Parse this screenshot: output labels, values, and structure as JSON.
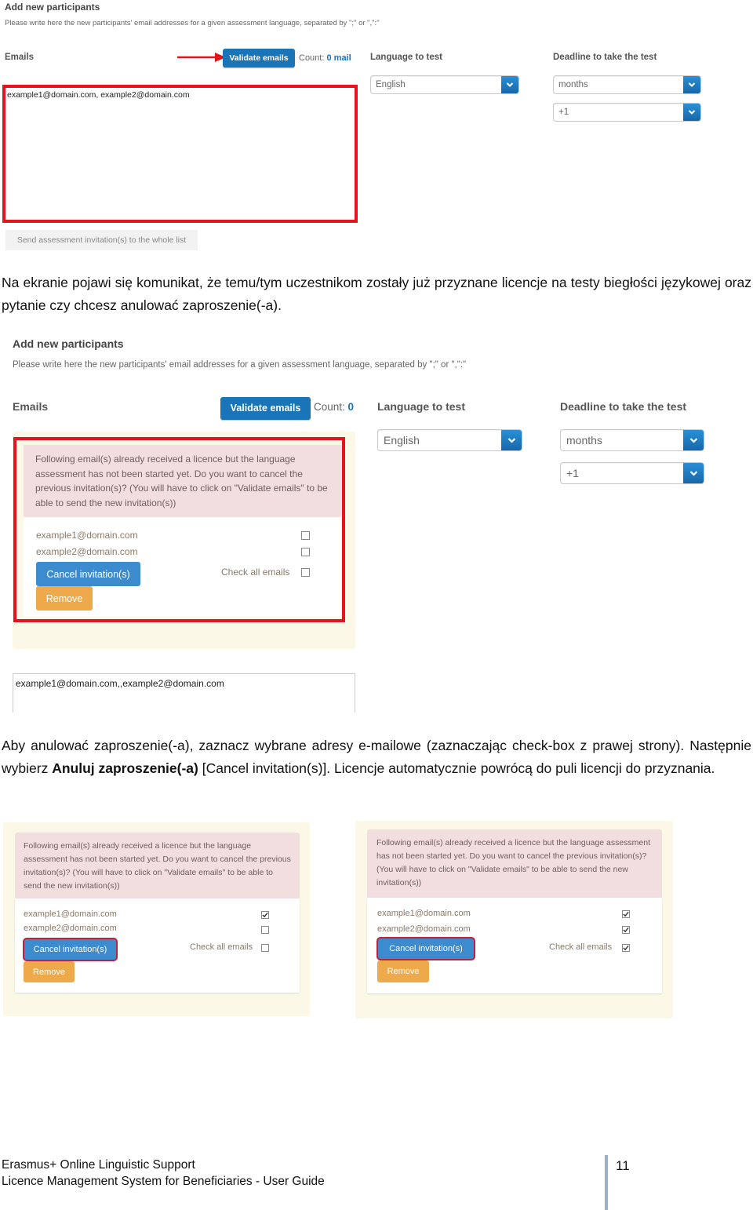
{
  "screenshot1": {
    "title": "Add new participants",
    "subtitle": "Please write here the new participants' email addresses for a given assessment language, separated by \";\" or \",\":\"",
    "emails_label": "Emails",
    "validate_label": "Validate emails",
    "count_prefix": "Count:",
    "count_value": "0 mail",
    "language_label": "Language to test",
    "language_value": "English",
    "deadline_label": "Deadline to take the test",
    "deadline_unit": "months",
    "deadline_amount": "+1",
    "emails_value": "example1@domain.com, example2@domain.com",
    "send_label": "Send assessment invitation(s) to the whole list",
    "annotation_color": "#e3141b"
  },
  "paragraph1": "Na ekranie pojawi się komunikat, że temu/tym uczestnikom zostały już przyznane licencje na testy biegłości językowej oraz pytanie czy chcesz anulować zaproszenie(-a).",
  "screenshot2": {
    "title": "Add new participants",
    "subtitle": "Please write here the new participants' email addresses for a given assessment language, separated by \";\" or \",\":\"",
    "emails_label": "Emails",
    "validate_label": "Validate emails",
    "count_prefix": "Count:",
    "count_value": "0",
    "language_label": "Language to test",
    "language_value": "English",
    "deadline_label": "Deadline to take the test",
    "deadline_unit": "months",
    "deadline_amount": "+1",
    "alert_text": "Following email(s) already received a licence but the language assessment has not been started yet. Do you want to cancel the previous invitation(s)? (You will have to click on \"Validate emails\" to be able to send the new invitation(s))",
    "emails": [
      "example1@domain.com",
      "example2@domain.com"
    ],
    "checked": [
      false,
      false
    ],
    "cancel_label": "Cancel invitation(s)",
    "check_all_label": "Check all emails",
    "check_all_checked": false,
    "remove_label": "Remove",
    "emails_value": "example1@domain.com,,example2@domain.com"
  },
  "paragraph2": {
    "part1": "Aby anulować zaproszenie(-a), zaznacz wybrane adresy e-mailowe (zaznaczając check-box z prawej strony). Następnie wybierz ",
    "bold": "Anuluj zaproszenie(-a)",
    "part2": " [Cancel invitation(s)]. Licencje automatycznie powrócą do puli licencji do przyznania."
  },
  "screenshot3": {
    "alert_text": "Following email(s) already received a licence but the language assessment has not been started yet. Do you want to cancel the previous invitation(s)? (You will have to click on \"Validate emails\" to be able to send the new invitation(s))",
    "emails": [
      "example1@domain.com",
      "example2@domain.com"
    ],
    "checked": [
      true,
      false
    ],
    "cancel_label": "Cancel invitation(s)",
    "check_all_label": "Check all emails",
    "check_all_checked": false,
    "remove_label": "Remove"
  },
  "screenshot4": {
    "alert_text": "Following email(s) already received a licence but the language assessment has not been started yet. Do you want to cancel the previous invitation(s)? (You will have to click on \"Validate emails\" to be able to send the new invitation(s))",
    "emails": [
      "example1@domain.com",
      "example2@domain.com"
    ],
    "checked": [
      true,
      true
    ],
    "cancel_label": "Cancel invitation(s)",
    "check_all_label": "Check all emails",
    "check_all_checked": true,
    "remove_label": "Remove"
  },
  "footer": {
    "line1": "Erasmus+ Online Linguistic Support",
    "line2": "Licence Management System for Beneficiaries - User Guide",
    "page_number": "11"
  }
}
